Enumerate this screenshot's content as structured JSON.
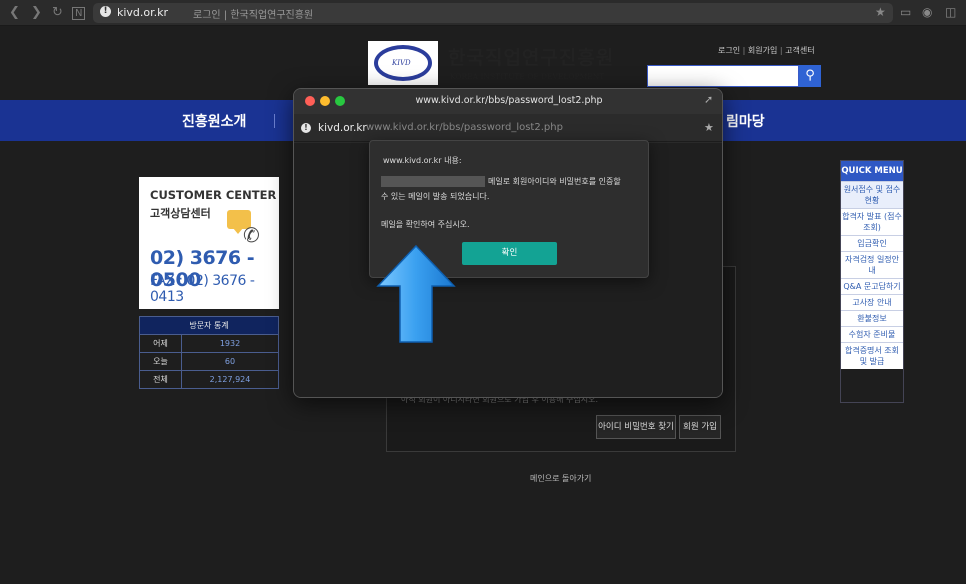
{
  "browser": {
    "domain": "kivd.or.kr",
    "page_title": "로그인 | 한국직업연구진흥원"
  },
  "site": {
    "logo_text": "KIVD",
    "name_ko": "한국직업연구진흥원",
    "name_en": "KOREA INSTITUTE OF DEVELOPMENT",
    "top_links": [
      "로그인",
      "회원가입",
      "고객센터"
    ],
    "nav": [
      "진흥원소개",
      "림마당"
    ]
  },
  "customer_center": {
    "title_en": "CUSTOMER CENTER",
    "title_ko": "고객상담센터",
    "phone": "02) 3676 - 0500",
    "fax": "FAX : 02) 3676 - 0413"
  },
  "visitor_stats": {
    "title": "방문자 통계",
    "rows": [
      {
        "label": "어제",
        "value": "1932"
      },
      {
        "label": "오늘",
        "value": "60"
      },
      {
        "label": "전체",
        "value": "2,127,924"
      }
    ]
  },
  "quick_menu": {
    "title": "QUICK MENU",
    "items": [
      "원서접수 및 접수현황",
      "합격자 발표 (점수 조회)",
      "입금확인",
      "자격검정 일정안내",
      "Q&A 문고답하기",
      "고사장 안내",
      "환불정보",
      "수험자 준비물",
      "합격증명서 조회 및 발급"
    ]
  },
  "content": {
    "help_text": "아직 회원이 아니시라면 회원으로 가입 후 이용해 주십시오.",
    "find_button": "아이디 비밀번호 찾기",
    "join_button": "회원 가입",
    "back_link": "메인으로 돌아가기"
  },
  "popup": {
    "title": "www.kivd.or.kr/bbs/password_lost2.php",
    "domain": "kivd.or.kr",
    "url": "www.kivd.or.kr/bbs/password_lost2.php"
  },
  "dialog": {
    "title": "www.kivd.or.kr 내용:",
    "message_line1": "메일로 회원아이디와 비밀번호를 인증할",
    "message_line2": "수 있는 메일이 발송 되었습니다.",
    "message_line3": "메일을 확인하여 주십시오.",
    "ok_label": "확인"
  },
  "colors": {
    "nav_blue": "#1a3393",
    "ok_button": "#13a394",
    "arrow": "#3aa0f0"
  }
}
